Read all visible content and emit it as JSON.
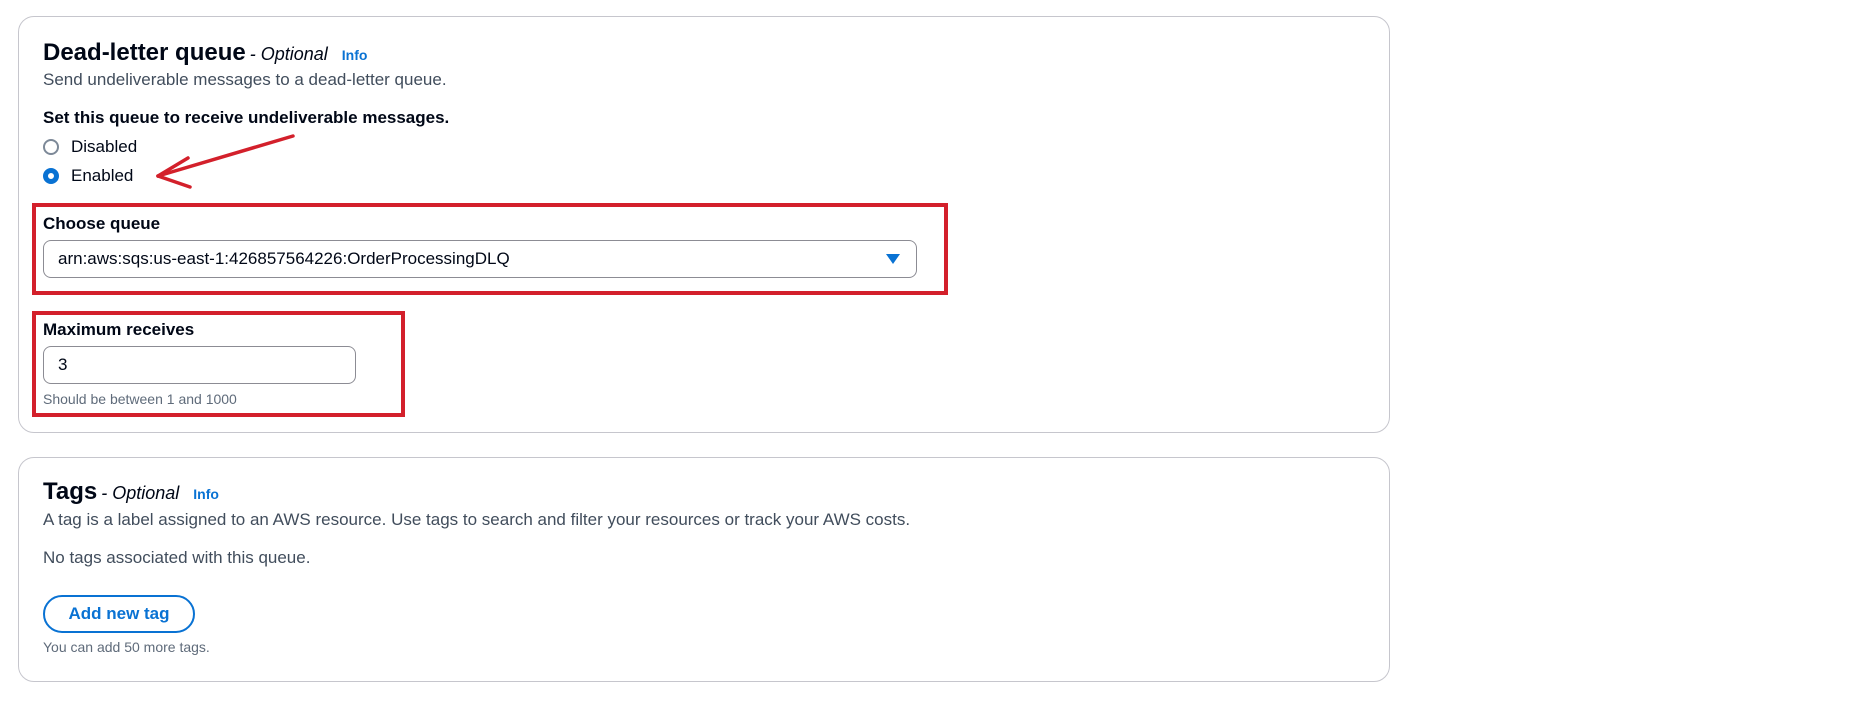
{
  "dead_letter_queue": {
    "title": "Dead-letter queue",
    "optional": "- Optional",
    "info": "Info",
    "description": "Send undeliverable messages to a dead-letter queue.",
    "setting_label": "Set this queue to receive undeliverable messages.",
    "options": [
      {
        "label": "Disabled",
        "selected": false
      },
      {
        "label": "Enabled",
        "selected": true
      }
    ],
    "choose_queue": {
      "label": "Choose queue",
      "value": "arn:aws:sqs:us-east-1:426857564226:OrderProcessingDLQ"
    },
    "max_receives": {
      "label": "Maximum receives",
      "value": "3",
      "hint": "Should be between 1 and 1000"
    }
  },
  "tags": {
    "title": "Tags",
    "optional": "- Optional",
    "info": "Info",
    "description": "A tag is a label assigned to an AWS resource. Use tags to search and filter your resources or track your AWS costs.",
    "empty_text": "No tags associated with this queue.",
    "add_button": "Add new tag",
    "hint": "You can add 50 more tags."
  },
  "colors": {
    "accent": "#0972d3",
    "annotation": "#d3202b",
    "border": "#c6c6cd"
  }
}
